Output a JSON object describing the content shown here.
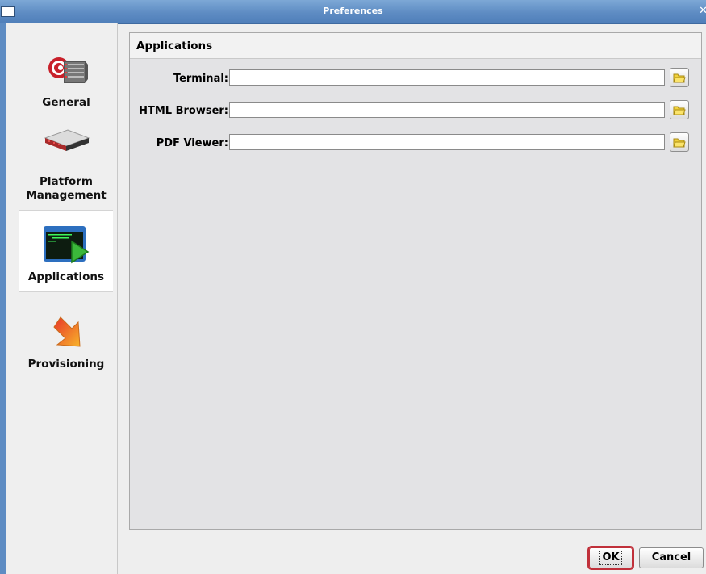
{
  "window": {
    "title": "Preferences"
  },
  "sidebar": {
    "items": [
      {
        "label": "General",
        "icon": "database-server-icon"
      },
      {
        "label": "Platform\nManagement",
        "icon": "rack-server-icon"
      },
      {
        "label": "Applications",
        "icon": "terminal-app-icon",
        "selected": true
      },
      {
        "label": "Provisioning",
        "icon": "arrow-down-right-icon"
      }
    ]
  },
  "panel": {
    "header": "Applications",
    "fields": [
      {
        "label": "Terminal:",
        "value": "",
        "browse_icon": "folder-icon"
      },
      {
        "label": "HTML Browser:",
        "value": "",
        "browse_icon": "folder-icon"
      },
      {
        "label": "PDF Viewer:",
        "value": "",
        "browse_icon": "folder-icon"
      }
    ]
  },
  "buttons": {
    "ok": "OK",
    "cancel": "Cancel"
  },
  "colors": {
    "titlebar": "#5e8cc3",
    "focus_outline": "#c0303a",
    "panel_bg": "#e3e3e5"
  }
}
